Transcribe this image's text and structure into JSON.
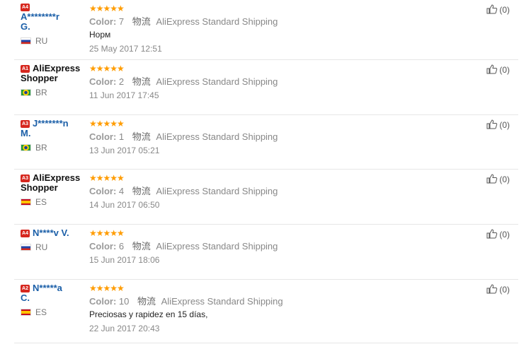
{
  "reviews": [
    {
      "level": "A4",
      "name_line1": "A********r",
      "name_line2": "G.",
      "name_color": "blue",
      "country": "RU",
      "flag": "ru",
      "stars": "★★★★★",
      "color_label": "Color:",
      "color_value": "7",
      "shipping_cn": "物流",
      "shipping": "AliExpress Standard Shipping",
      "comment": "Норм",
      "date": "25 May 2017 12:51",
      "helpful": "(0)"
    },
    {
      "level": "A1",
      "name_line1": "AliExpress",
      "name_line2": "Shopper",
      "name_color": "black",
      "country": "BR",
      "flag": "br",
      "stars": "★★★★★",
      "color_label": "Color:",
      "color_value": "2",
      "shipping_cn": "物流",
      "shipping": "AliExpress Standard Shipping",
      "comment": "",
      "date": "11 Jun 2017 17:45",
      "helpful": "(0)"
    },
    {
      "level": "A3",
      "name_line1": "J*******n",
      "name_line2": "M.",
      "name_color": "blue",
      "country": "BR",
      "flag": "br",
      "stars": "★★★★★",
      "color_label": "Color:",
      "color_value": "1",
      "shipping_cn": "物流",
      "shipping": "AliExpress Standard Shipping",
      "comment": "",
      "date": "13 Jun 2017 05:21",
      "helpful": "(0)"
    },
    {
      "level": "A3",
      "name_line1": "AliExpress",
      "name_line2": "Shopper",
      "name_color": "black",
      "country": "ES",
      "flag": "es",
      "stars": "★★★★★",
      "color_label": "Color:",
      "color_value": "4",
      "shipping_cn": "物流",
      "shipping": "AliExpress Standard Shipping",
      "comment": "",
      "date": "14 Jun 2017 06:50",
      "helpful": "(0)"
    },
    {
      "level": "A4",
      "name_line1": "N****v V.",
      "name_line2": "",
      "name_color": "blue",
      "country": "RU",
      "flag": "ru",
      "stars": "★★★★★",
      "color_label": "Color:",
      "color_value": "6",
      "shipping_cn": "物流",
      "shipping": "AliExpress Standard Shipping",
      "comment": "",
      "date": "15 Jun 2017 18:06",
      "helpful": "(0)"
    },
    {
      "level": "A2",
      "name_line1": "N*****a",
      "name_line2": "C.",
      "name_color": "blue",
      "country": "ES",
      "flag": "es",
      "stars": "★★★★★",
      "color_label": "Color:",
      "color_value": "10",
      "shipping_cn": "物流",
      "shipping": "AliExpress Standard Shipping",
      "comment": "Preciosas y rapidez en 15 días,",
      "date": "22 Jun 2017 20:43",
      "helpful": "(0)"
    }
  ]
}
